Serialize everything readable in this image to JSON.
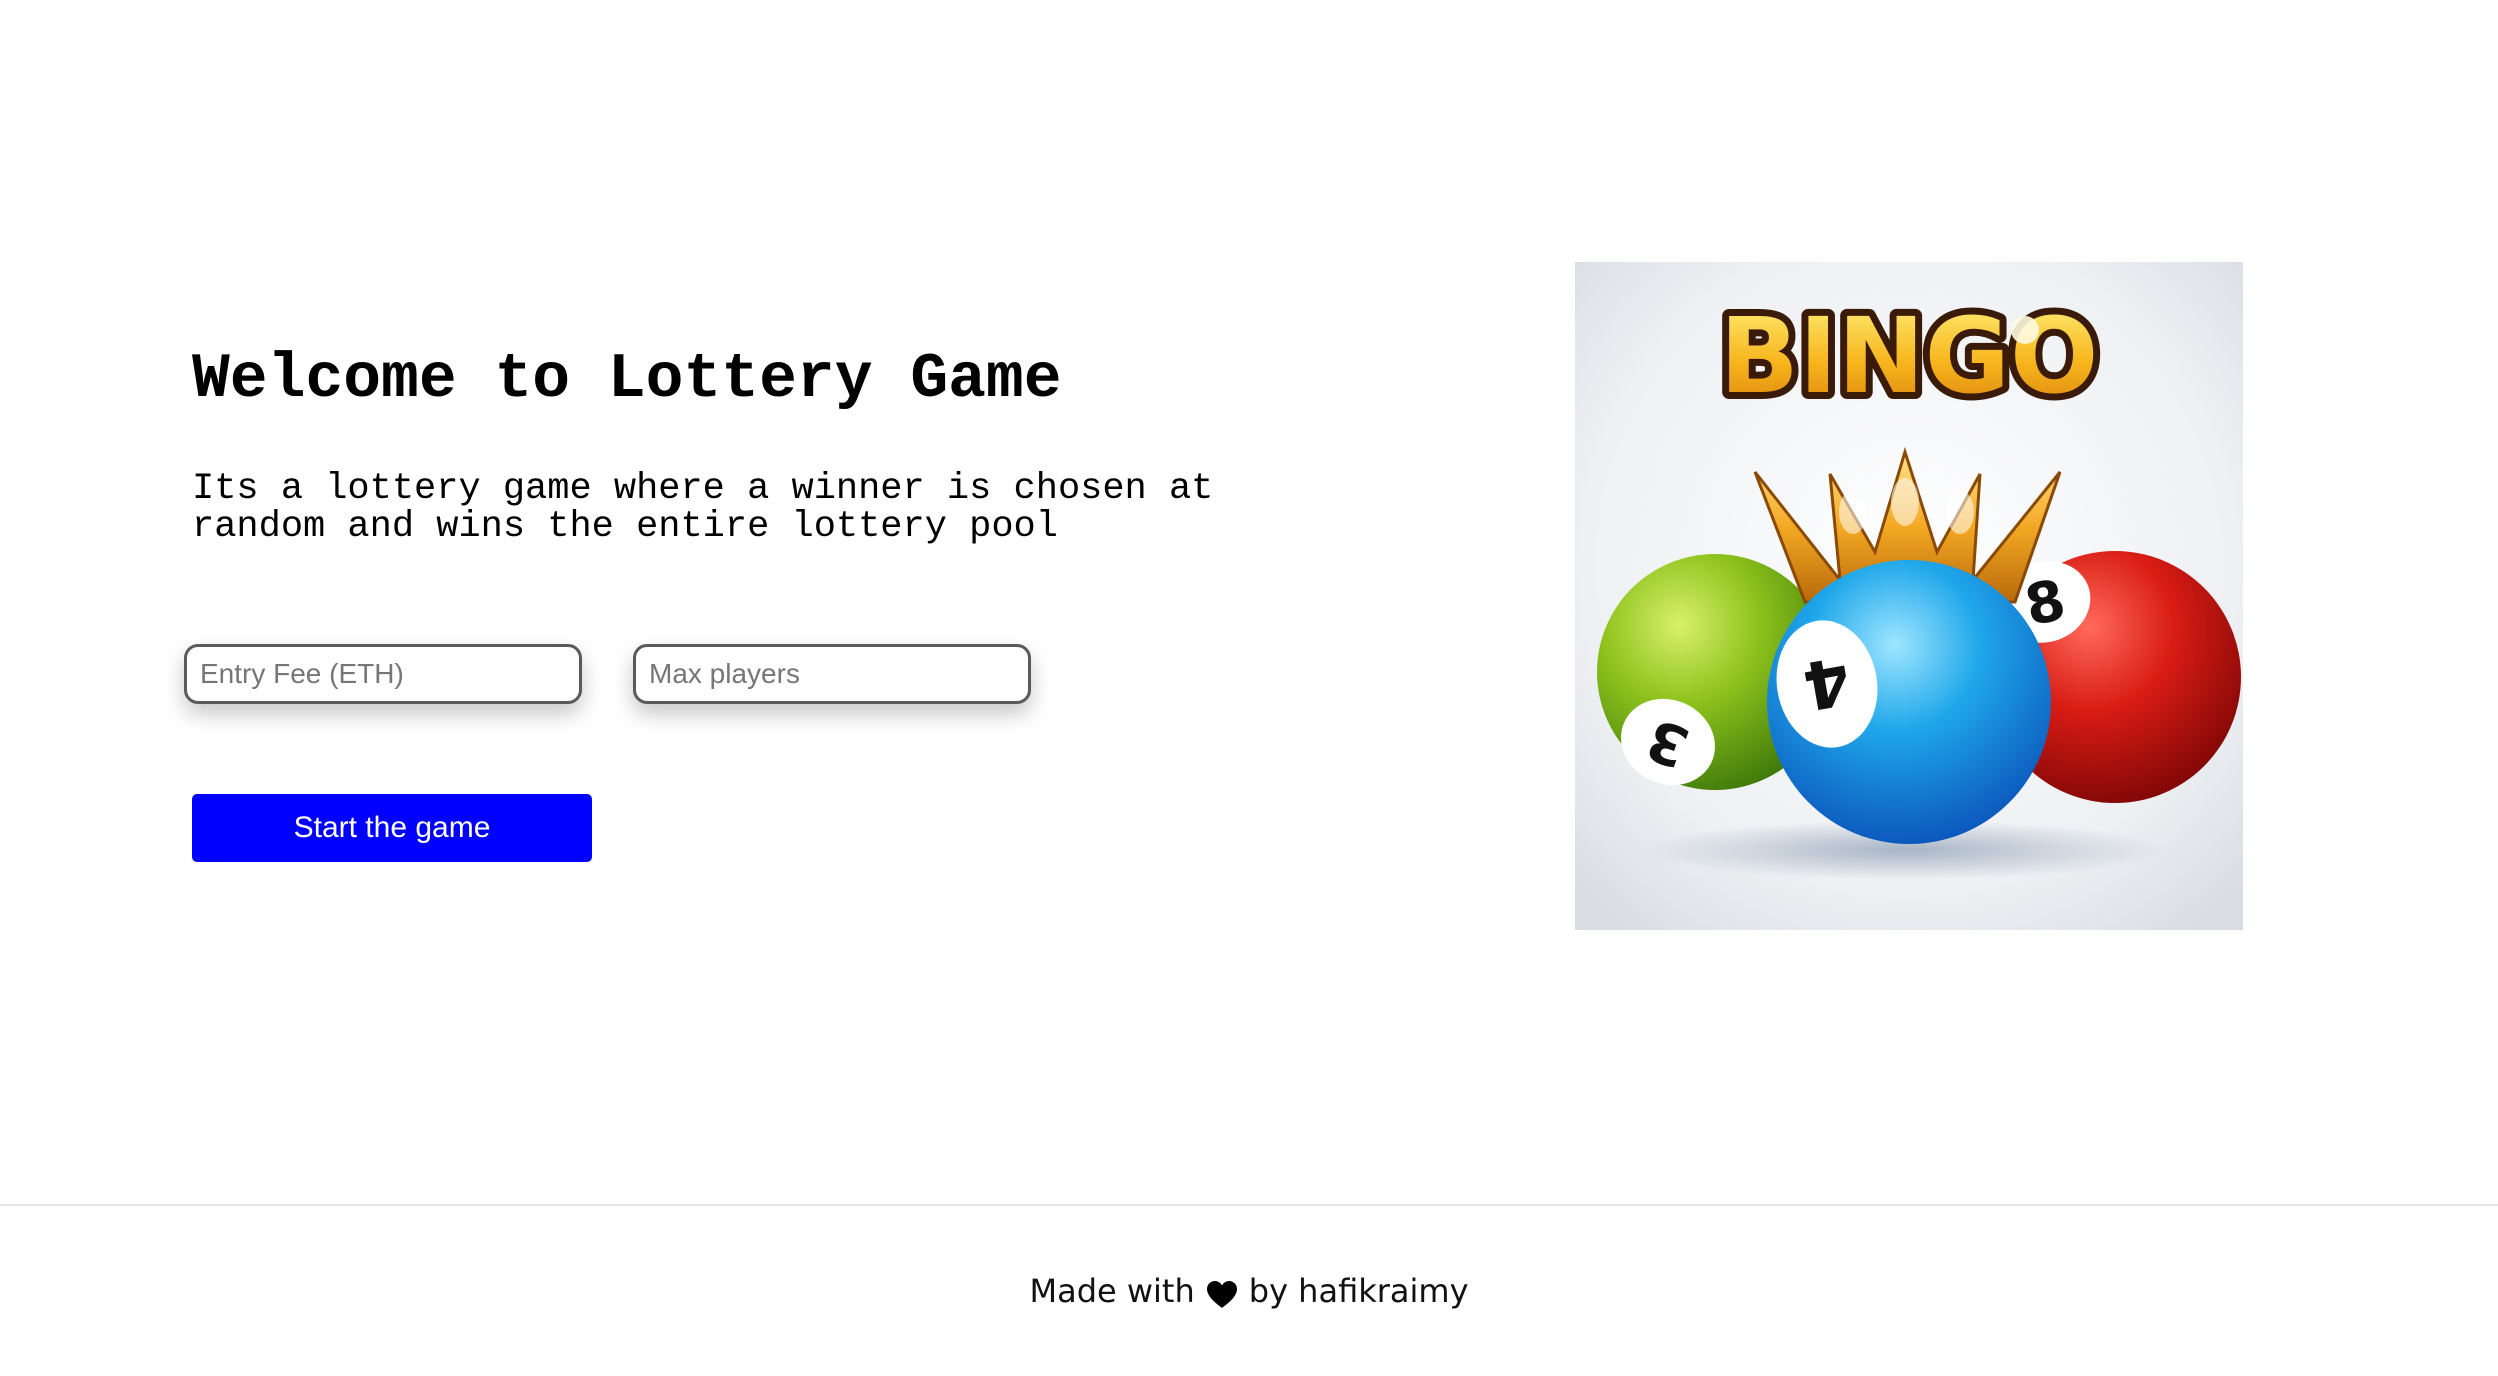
{
  "hero": {
    "title": "Welcome to Lottery Game",
    "description": "Its a lottery game where a winner is chosen at random and wins the entire lottery pool"
  },
  "form": {
    "entry_fee_placeholder": "Entry Fee (ETH)",
    "max_players_placeholder": "Max players",
    "start_label": "Start the game"
  },
  "image": {
    "logo_text": "BINGO",
    "ball_numbers": [
      "3",
      "4",
      "8"
    ],
    "icon": "bingo-balls-crown-illustration"
  },
  "footer": {
    "prefix": "Made with",
    "heart_icon": "heart-icon",
    "suffix": "by hafikraimy"
  },
  "colors": {
    "button_bg": "#0000ff",
    "button_text": "#ffffff",
    "text": "#000000"
  }
}
